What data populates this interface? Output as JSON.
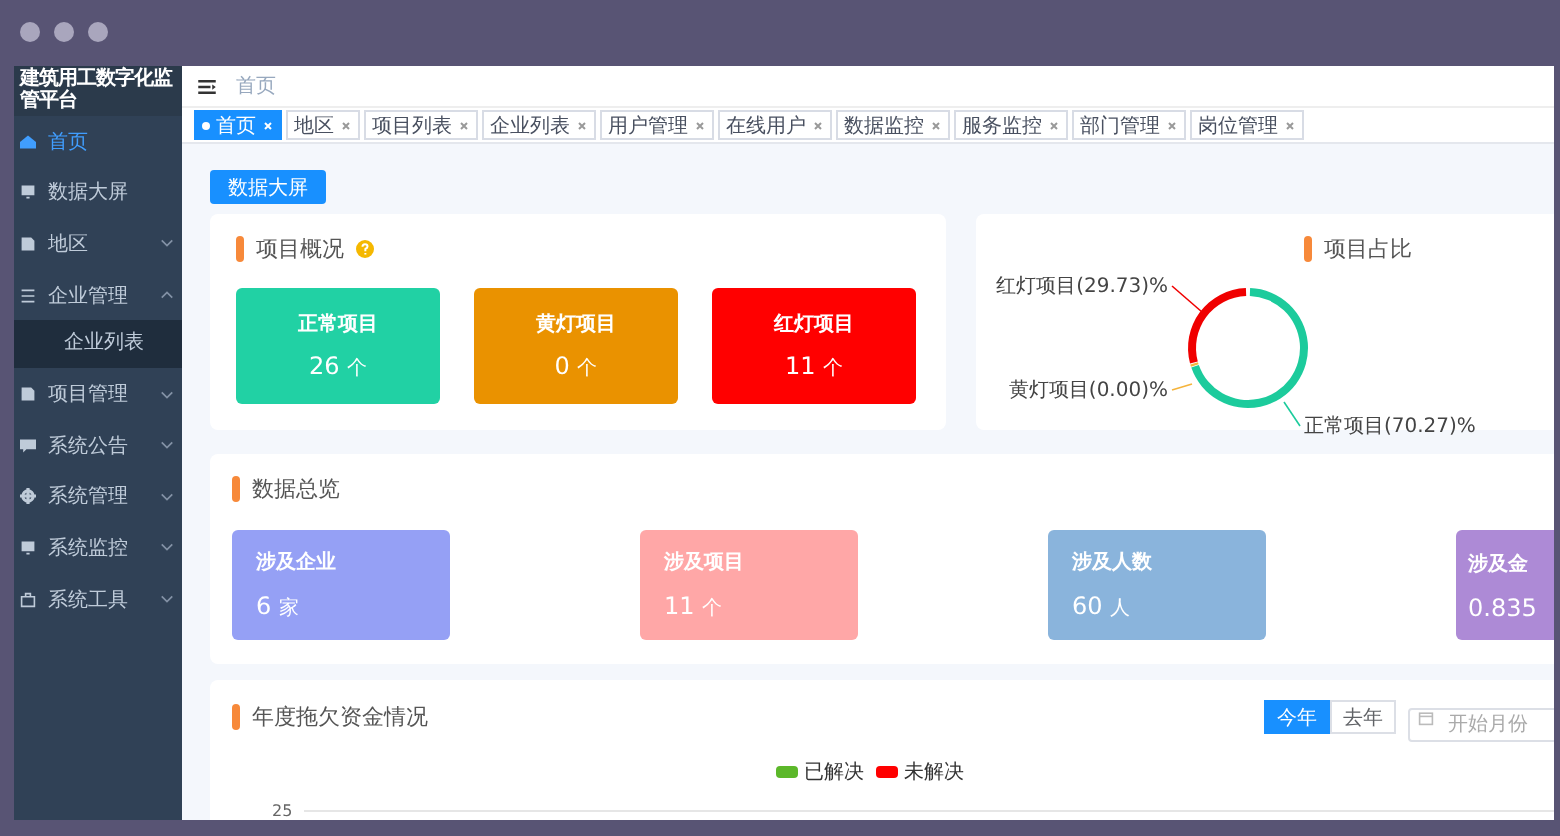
{
  "app": {
    "title": "建筑用工数字化监管平台"
  },
  "sidebar": {
    "items": [
      {
        "label": "首页",
        "kind": "link",
        "selected": true
      },
      {
        "label": "数据大屏",
        "kind": "link",
        "selected": false
      },
      {
        "label": "地区",
        "kind": "group",
        "selected": false,
        "expanded": false
      },
      {
        "label": "企业管理",
        "kind": "group",
        "selected": false,
        "expanded": true,
        "children": [
          {
            "label": "企业列表",
            "selected": false
          }
        ]
      },
      {
        "label": "项目管理",
        "kind": "group",
        "selected": false,
        "expanded": false
      },
      {
        "label": "系统公告",
        "kind": "group",
        "selected": false,
        "expanded": false
      },
      {
        "label": "系统管理",
        "kind": "group",
        "selected": false,
        "expanded": false
      },
      {
        "label": "系统监控",
        "kind": "group",
        "selected": false,
        "expanded": false
      },
      {
        "label": "系统工具",
        "kind": "group",
        "selected": false,
        "expanded": false
      }
    ]
  },
  "breadcrumb": "首页",
  "tabs": [
    {
      "label": "首页",
      "selected": true
    },
    {
      "label": "地区",
      "selected": false
    },
    {
      "label": "项目列表",
      "selected": false
    },
    {
      "label": "企业列表",
      "selected": false
    },
    {
      "label": "用户管理",
      "selected": false
    },
    {
      "label": "在线用户",
      "selected": false
    },
    {
      "label": "数据监控",
      "selected": false
    },
    {
      "label": "服务监控",
      "selected": false
    },
    {
      "label": "部门管理",
      "selected": false
    },
    {
      "label": "岗位管理",
      "selected": false
    }
  ],
  "screen_button": "数据大屏",
  "project_overview": {
    "title": "项目概况",
    "stats": [
      {
        "label": "正常项目",
        "value": "26",
        "unit": "个",
        "color": "#21d1a4"
      },
      {
        "label": "黄灯项目",
        "value": "0",
        "unit": "个",
        "color": "#ea9200"
      },
      {
        "label": "红灯项目",
        "value": "11",
        "unit": "个",
        "color": "#ff0000"
      }
    ]
  },
  "project_share": {
    "title": "项目占比",
    "slices": [
      {
        "color": "#f00000"
      },
      {
        "color": "#f5b43c"
      },
      {
        "color": "#1ccb9c"
      }
    ],
    "chart_data": {
      "type": "donut",
      "categories": [
        "红灯项目",
        "黄灯项目",
        "正常项目"
      ],
      "values": [
        29.73,
        0,
        70.27
      ],
      "value_labels": [
        "(29.73)%",
        "(0.00)%",
        "(70.27)%"
      ]
    }
  },
  "data_overview": {
    "title": "数据总览",
    "stats": [
      {
        "label": "涉及企业",
        "value": "6",
        "unit": "家",
        "color": "#95a0f5"
      },
      {
        "label": "涉及项目",
        "value": "11",
        "unit": "个",
        "color": "#ffa7a7"
      },
      {
        "label": "涉及人数",
        "value": "60",
        "unit": "人",
        "color": "#8ab4dc"
      },
      {
        "label": "涉及金",
        "value": "0.835",
        "color": "#ad8ad6"
      }
    ]
  },
  "arrears": {
    "title": "年度拖欠资金情况",
    "periods": [
      {
        "label": "今年",
        "selected": true
      },
      {
        "label": "去年",
        "selected": false
      }
    ],
    "month_picker": {
      "placeholder": "开始月份"
    },
    "legend": [
      {
        "label": "已解决",
        "color": "#5cb82a"
      },
      {
        "label": "未解决",
        "color": "#ff0000"
      }
    ],
    "y_tick": "25"
  }
}
